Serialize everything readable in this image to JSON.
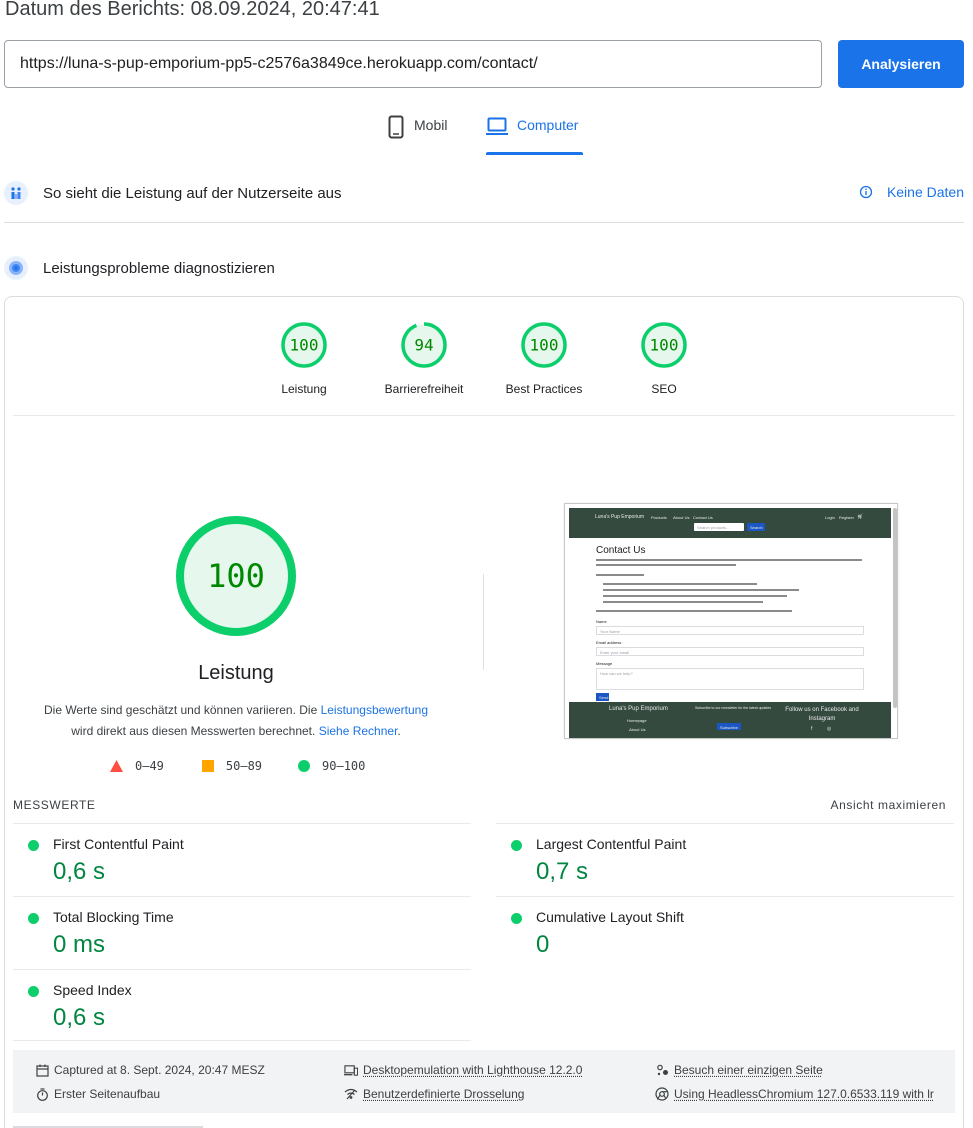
{
  "report": {
    "date_label": "Datum des Berichts: 08.09.2024, 20:47:41"
  },
  "url_bar": {
    "value": "https://luna-s-pup-emporium-pp5-c2576a3849ce.herokuapp.com/contact/",
    "analyze_label": "Analysieren"
  },
  "device_tabs": [
    {
      "label": "Mobil",
      "icon": "smartphone-icon",
      "selected": false
    },
    {
      "label": "Computer",
      "icon": "laptop-icon",
      "selected": true
    }
  ],
  "field_section": {
    "title": "So sieht die Leistung auf der Nutzerseite aus",
    "status": "Keine Daten"
  },
  "diagnose_section": {
    "title": "Leistungsprobleme diagnostizieren"
  },
  "scores": [
    {
      "label": "Leistung",
      "value": "100",
      "fraction": 1.0
    },
    {
      "label": "Barrierefreiheit",
      "value": "94",
      "fraction": 0.94
    },
    {
      "label": "Best Practices",
      "value": "100",
      "fraction": 1.0
    },
    {
      "label": "SEO",
      "value": "100",
      "fraction": 1.0
    }
  ],
  "performance": {
    "score": "100",
    "fraction": 1.0,
    "title": "Leistung",
    "desc_part1": "Die Werte sind geschätzt und können variieren. Die ",
    "desc_link1": "Leistungsbewertung",
    "desc_part2": " wird direkt aus diesen Messwerten berechnet. ",
    "desc_link2": "Siehe Rechner",
    "desc_part3": "."
  },
  "legend": [
    {
      "range": "0–49",
      "shape": "triangle",
      "color": "#ff4e42"
    },
    {
      "range": "50–89",
      "shape": "square",
      "color": "#ffa400"
    },
    {
      "range": "90–100",
      "shape": "circle",
      "color": "#0cce6b"
    }
  ],
  "screenshot": {
    "brand": "Luna's Pup Emporium",
    "nav_products": "Products",
    "nav_about": "About Us",
    "nav_contact": "Contact Us",
    "nav_login": "Login",
    "nav_register": "Register",
    "search_placeholder": "Search products...",
    "search_button": "Search",
    "page_title": "Contact Us",
    "label_name": "Name",
    "placeholder_name": "Your Name",
    "label_email": "Email address",
    "placeholder_email": "Enter your email",
    "label_message": "Message",
    "placeholder_message": "How can we help?",
    "send_button": "Send",
    "footer_brand": "Luna's Pup Emporium",
    "footer_home": "Homepage",
    "footer_about": "About Us",
    "footer_newsletter": "Subscribe to our newsletter for the latest updates",
    "footer_subscribe": "Subscribe",
    "footer_follow": "Follow us on Facebook and Instagram"
  },
  "metrics": {
    "section_label": "MESSWERTE",
    "expand_label": "Ansicht maximieren",
    "items": [
      {
        "label": "First Contentful Paint",
        "value": "0,6 s"
      },
      {
        "label": "Largest Contentful Paint",
        "value": "0,7 s"
      },
      {
        "label": "Total Blocking Time",
        "value": "0 ms"
      },
      {
        "label": "Cumulative Layout Shift",
        "value": "0"
      },
      {
        "label": "Speed Index",
        "value": "0,6 s"
      }
    ],
    "status_color": "#0cce6b",
    "value_color": "#018642"
  },
  "environment": [
    {
      "text": "Captured at 8. Sept. 2024, 20:47 MESZ",
      "icon": "calendar-icon"
    },
    {
      "text": "Desktopemulation with Lighthouse 12.2.0",
      "icon": "devices-icon"
    },
    {
      "text": "Besuch einer einzigen Seite",
      "icon": "single-visit-icon"
    },
    {
      "text": "Erster Seitenaufbau",
      "icon": "stopwatch-icon"
    },
    {
      "text": "Benutzerdefinierte Drosselung",
      "icon": "network-icon"
    },
    {
      "text": "Using HeadlessChromium 127.0.6533.119 with lr",
      "icon": "chromium-icon"
    }
  ],
  "colors": {
    "accent": "#1a73e8",
    "pass": "#0cce6b",
    "pass_text": "#008800",
    "pass_fill": "#e6f8ee"
  }
}
